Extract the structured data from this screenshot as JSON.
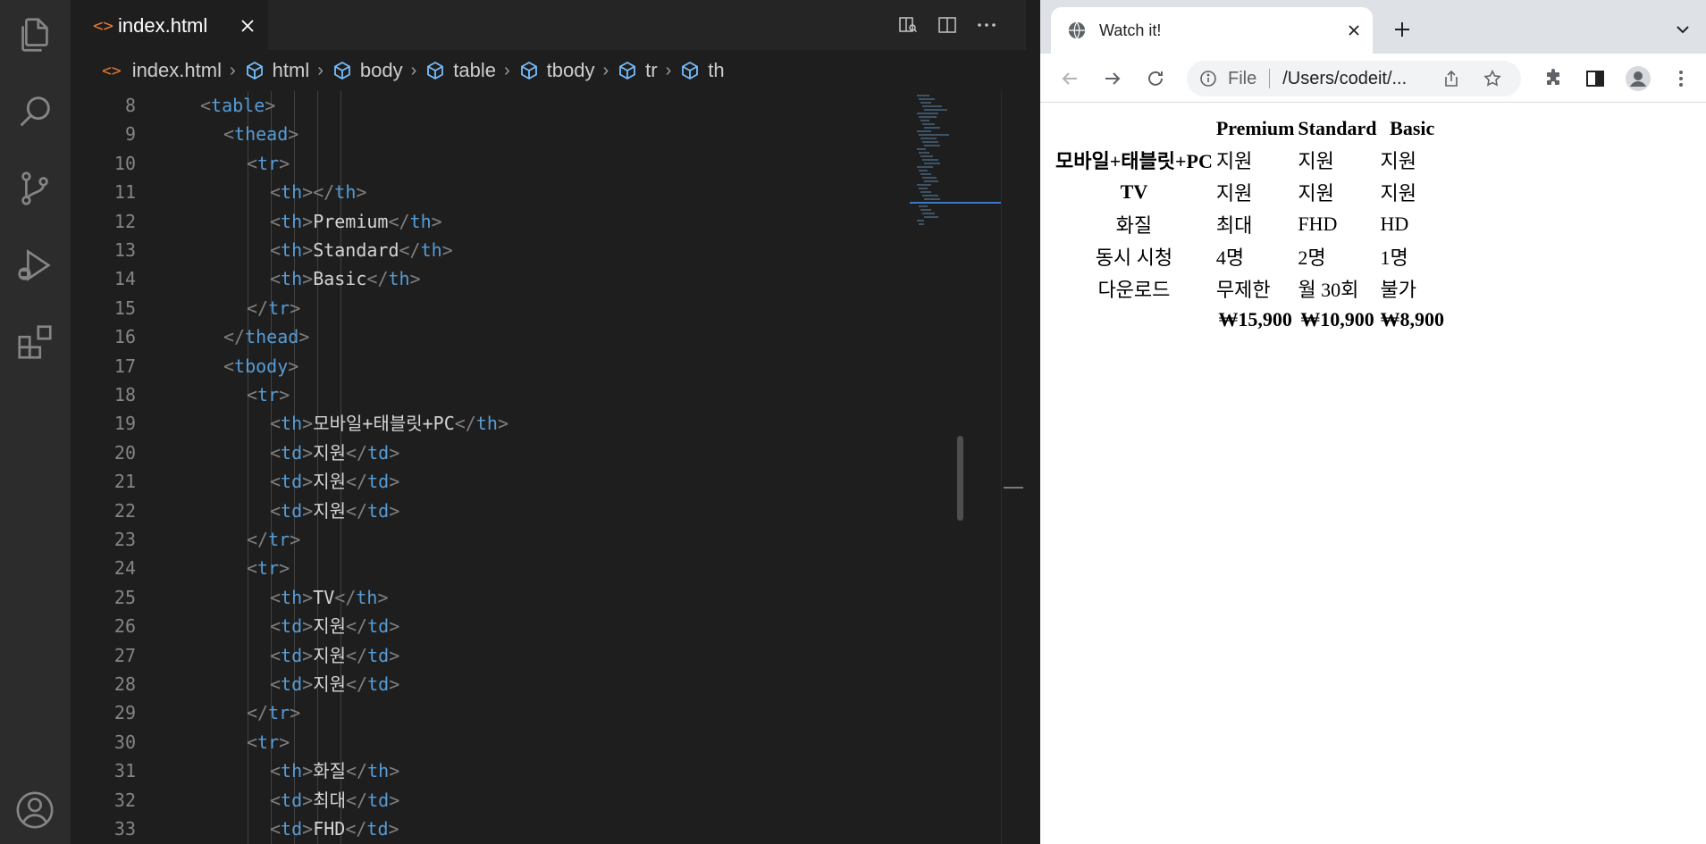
{
  "editor": {
    "tab": {
      "icon": "<>",
      "label": "index.html"
    },
    "breadcrumb": [
      {
        "label": "index.html",
        "icon": "html-file-icon"
      },
      {
        "label": "html",
        "icon": "symbol-element-icon"
      },
      {
        "label": "body",
        "icon": "symbol-element-icon"
      },
      {
        "label": "table",
        "icon": "symbol-element-icon"
      },
      {
        "label": "tbody",
        "icon": "symbol-element-icon"
      },
      {
        "label": "tr",
        "icon": "symbol-element-icon"
      },
      {
        "label": "th",
        "icon": "symbol-element-icon"
      }
    ],
    "lines": [
      {
        "n": "8",
        "depth": 2,
        "tag": "table",
        "close": false
      },
      {
        "n": "9",
        "depth": 3,
        "tag": "thead",
        "close": false
      },
      {
        "n": "10",
        "depth": 4,
        "tag": "tr",
        "close": false
      },
      {
        "n": "11",
        "depth": 5,
        "tag": "th",
        "text": "",
        "inline": true
      },
      {
        "n": "12",
        "depth": 5,
        "tag": "th",
        "text": "Premium",
        "inline": true
      },
      {
        "n": "13",
        "depth": 5,
        "tag": "th",
        "text": "Standard",
        "inline": true
      },
      {
        "n": "14",
        "depth": 5,
        "tag": "th",
        "text": "Basic",
        "inline": true
      },
      {
        "n": "15",
        "depth": 4,
        "tag": "tr",
        "close": true
      },
      {
        "n": "16",
        "depth": 3,
        "tag": "thead",
        "close": true
      },
      {
        "n": "17",
        "depth": 3,
        "tag": "tbody",
        "close": false
      },
      {
        "n": "18",
        "depth": 4,
        "tag": "tr",
        "close": false
      },
      {
        "n": "19",
        "depth": 5,
        "tag": "th",
        "text": "모바일+태블릿+PC",
        "inline": true
      },
      {
        "n": "20",
        "depth": 5,
        "tag": "td",
        "text": "지원",
        "inline": true
      },
      {
        "n": "21",
        "depth": 5,
        "tag": "td",
        "text": "지원",
        "inline": true
      },
      {
        "n": "22",
        "depth": 5,
        "tag": "td",
        "text": "지원",
        "inline": true
      },
      {
        "n": "23",
        "depth": 4,
        "tag": "tr",
        "close": true
      },
      {
        "n": "24",
        "depth": 4,
        "tag": "tr",
        "close": false
      },
      {
        "n": "25",
        "depth": 5,
        "tag": "th",
        "text": "TV",
        "inline": true
      },
      {
        "n": "26",
        "depth": 5,
        "tag": "td",
        "text": "지원",
        "inline": true
      },
      {
        "n": "27",
        "depth": 5,
        "tag": "td",
        "text": "지원",
        "inline": true
      },
      {
        "n": "28",
        "depth": 5,
        "tag": "td",
        "text": "지원",
        "inline": true
      },
      {
        "n": "29",
        "depth": 4,
        "tag": "tr",
        "close": true
      },
      {
        "n": "30",
        "depth": 4,
        "tag": "tr",
        "close": false
      },
      {
        "n": "31",
        "depth": 5,
        "tag": "th",
        "text": "화질",
        "inline": true
      },
      {
        "n": "32",
        "depth": 5,
        "tag": "td",
        "text": "최대",
        "inline": true
      },
      {
        "n": "33",
        "depth": 5,
        "tag": "td",
        "text": "FHD",
        "inline": true
      }
    ],
    "colors": {
      "tag": "#569cd6",
      "punct": "#808080",
      "text": "#d4d4d4",
      "linenum": "#858585"
    }
  },
  "browser": {
    "tab_title": "Watch it!",
    "omnibox": {
      "scheme": "File",
      "url": "/Users/codeit/..."
    },
    "table": {
      "headers": [
        "",
        "Premium",
        "Standard",
        "Basic"
      ],
      "rows": [
        {
          "label": "모바일+태블릿+PC",
          "bold": true,
          "cells": [
            "지원",
            "지원",
            "지원"
          ]
        },
        {
          "label": "TV",
          "bold": true,
          "cells": [
            "지원",
            "지원",
            "지원"
          ]
        },
        {
          "label": "화질",
          "bold": false,
          "cells": [
            "최대",
            "FHD",
            "HD"
          ]
        },
        {
          "label": "동시 시청",
          "bold": false,
          "cells": [
            "4명",
            "2명",
            "1명"
          ]
        },
        {
          "label": "다운로드",
          "bold": false,
          "cells": [
            "무제한",
            "월 30회",
            "불가"
          ]
        }
      ],
      "footer": [
        "",
        "₩15,900",
        "₩10,900",
        "₩8,900"
      ]
    }
  }
}
